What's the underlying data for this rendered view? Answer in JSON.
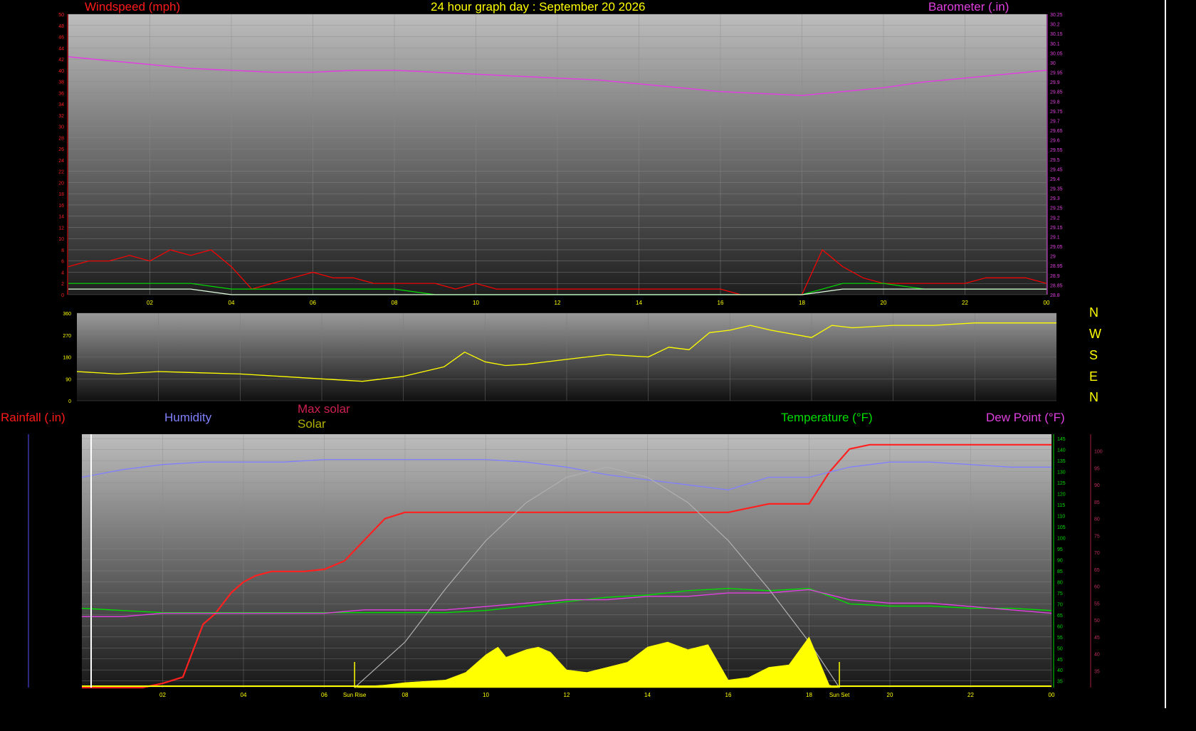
{
  "chart_data": [
    {
      "type": "line",
      "title": "24 hour graph day : September 20 2026",
      "left_axis_label": "Windspeed (mph)",
      "right_axis_label": "Barometer (.in)",
      "x_ticks": [
        "02",
        "04",
        "06",
        "08",
        "10",
        "12",
        "14",
        "16",
        "18",
        "20",
        "22",
        "00"
      ],
      "y_left_ticks": [
        "0",
        "2",
        "4",
        "6",
        "8",
        "10",
        "12",
        "14",
        "16",
        "18",
        "20",
        "22",
        "24",
        "26",
        "28",
        "30",
        "32",
        "34",
        "36",
        "38",
        "40",
        "42",
        "44",
        "46",
        "48",
        "50"
      ],
      "y_right_ticks": [
        "28.8",
        "28.85",
        "28.9",
        "28.95",
        "29",
        "29.05",
        "29.1",
        "29.15",
        "29.2",
        "29.25",
        "29.3",
        "29.35",
        "29.4",
        "29.45",
        "29.5",
        "29.55",
        "29.6",
        "29.65",
        "29.7",
        "29.75",
        "29.8",
        "29.85",
        "29.9",
        "29.95",
        "30",
        "30.05",
        "30.1",
        "30.15",
        "30.2",
        "30.25"
      ],
      "ylim_left": [
        0,
        50
      ],
      "ylim_right": [
        28.8,
        30.25
      ],
      "x_range_hours": [
        0,
        24
      ],
      "series": [
        {
          "name": "Barometer (.in)",
          "color": "#e040e0",
          "x": [
            0,
            1,
            2,
            3,
            4,
            5,
            6,
            7,
            8,
            9,
            10,
            11,
            12,
            13,
            14,
            15,
            16,
            17,
            18,
            19,
            20,
            21,
            22,
            23,
            24
          ],
          "values": [
            30.03,
            30.01,
            29.99,
            29.97,
            29.96,
            29.95,
            29.95,
            29.96,
            29.96,
            29.95,
            29.94,
            29.93,
            29.92,
            29.91,
            29.89,
            29.87,
            29.85,
            29.84,
            29.83,
            29.85,
            29.87,
            29.9,
            29.92,
            29.94,
            29.96
          ]
        },
        {
          "name": "Gust",
          "color": "#ff0000",
          "x": [
            0,
            0.5,
            1,
            1.5,
            2,
            2.5,
            3,
            3.5,
            4,
            4.5,
            5,
            5.5,
            6,
            6.5,
            7,
            7.5,
            8,
            8.5,
            9,
            9.5,
            10,
            10.5,
            11,
            11.5,
            12,
            12.5,
            13,
            13.5,
            14,
            14.5,
            15,
            15.5,
            16,
            16.5,
            17,
            17.5,
            18,
            18.5,
            19,
            19.5,
            20,
            20.5,
            21,
            21.5,
            22,
            22.5,
            23,
            23.5,
            24
          ],
          "values": [
            5,
            6,
            6,
            7,
            6,
            8,
            7,
            8,
            5,
            1,
            2,
            3,
            4,
            3,
            3,
            2,
            2,
            2,
            2,
            1,
            2,
            1,
            1,
            1,
            1,
            1,
            1,
            1,
            1,
            1,
            1,
            1,
            1,
            0,
            0,
            0,
            0,
            8,
            5,
            3,
            2,
            2,
            2,
            2,
            2,
            3,
            3,
            3,
            2
          ]
        },
        {
          "name": "Average",
          "color": "#00dd00",
          "x": [
            0,
            1,
            2,
            3,
            4,
            5,
            6,
            7,
            8,
            9,
            10,
            11,
            12,
            13,
            14,
            15,
            16,
            17,
            18,
            19,
            20,
            21,
            22,
            23,
            24
          ],
          "values": [
            2,
            2,
            2,
            2,
            1,
            1,
            1,
            1,
            1,
            0,
            0,
            0,
            0,
            0,
            0,
            0,
            0,
            0,
            0,
            2,
            2,
            1,
            1,
            1,
            1
          ]
        },
        {
          "name": "Speed",
          "color": "#e0ffe0",
          "x": [
            0,
            1,
            2,
            3,
            4,
            5,
            6,
            7,
            8,
            9,
            10,
            11,
            12,
            13,
            14,
            15,
            16,
            17,
            18,
            19,
            20,
            21,
            22,
            23,
            24
          ],
          "values": [
            1,
            1,
            1,
            1,
            0,
            0,
            0,
            0,
            0,
            0,
            0,
            0,
            0,
            0,
            0,
            0,
            0,
            0,
            0,
            1,
            1,
            1,
            1,
            1,
            1
          ]
        }
      ]
    },
    {
      "type": "scatter",
      "title": "",
      "y_ticks": [
        "0",
        "90",
        "180",
        "270",
        "360"
      ],
      "ylim": [
        0,
        360
      ],
      "direction_labels": [
        "N",
        "W",
        "S",
        "E",
        "N"
      ],
      "series": [
        {
          "name": "Wind direction",
          "color": "#ffff00",
          "x": [
            0,
            1,
            2,
            3,
            4,
            5,
            6,
            7,
            8,
            9,
            9.5,
            10,
            10.5,
            11,
            12,
            13,
            14,
            14.5,
            15,
            15.5,
            16,
            16.5,
            17,
            18,
            18.5,
            19,
            20,
            21,
            22,
            23,
            24
          ],
          "values": [
            120,
            110,
            120,
            115,
            110,
            100,
            90,
            80,
            100,
            140,
            200,
            160,
            145,
            150,
            170,
            190,
            180,
            220,
            210,
            280,
            290,
            310,
            290,
            260,
            310,
            300,
            310,
            310,
            320,
            320,
            320
          ]
        }
      ]
    },
    {
      "type": "line",
      "title": "",
      "left_axis_label": "Rainfall (.in)",
      "humidity_label": "Humidity",
      "max_solar_label": "Max solar",
      "solar_label": "Solar",
      "temperature_label": "Temperature (°F)",
      "dew_point_label": "Dew Point (°F)",
      "x_ticks": [
        "02",
        "04",
        "06",
        "08",
        "10",
        "12",
        "14",
        "16",
        "18",
        "20",
        "22",
        "00"
      ],
      "sunrise_label": "Sun Rise",
      "sunset_label": "Sun Set",
      "sunrise_hour": 6.75,
      "sunset_hour": 18.75,
      "temp_ticks": [
        "35",
        "40",
        "45",
        "50",
        "55",
        "60",
        "65",
        "70",
        "75",
        "80",
        "85",
        "90",
        "95",
        "100",
        "105",
        "110",
        "115",
        "120",
        "125",
        "130",
        "135",
        "140",
        "145"
      ],
      "dew_ticks": [
        "35",
        "40",
        "45",
        "50",
        "55",
        "60",
        "65",
        "70",
        "75",
        "80",
        "85",
        "90",
        "95",
        "100"
      ],
      "temp_range": [
        32,
        147
      ],
      "dew_range": [
        30,
        105
      ],
      "rain_range": [
        0,
        1.2
      ],
      "humidity_range": [
        0,
        100
      ],
      "solar_range": [
        0,
        1000
      ],
      "series": [
        {
          "name": "Rainfall (.in)",
          "color": "#ff2020",
          "x": [
            0,
            0.5,
            1,
            1.5,
            2,
            2.5,
            3,
            3.3,
            3.7,
            4,
            4.3,
            4.7,
            5,
            5.5,
            6,
            6.5,
            7,
            7.5,
            8,
            9,
            10,
            11,
            12,
            13,
            14,
            15,
            16,
            16.5,
            17,
            18,
            18.5,
            19,
            19.5,
            20,
            21,
            22,
            23,
            24
          ],
          "values": [
            0,
            0,
            0,
            0,
            0.02,
            0.05,
            0.3,
            0.35,
            0.45,
            0.5,
            0.53,
            0.55,
            0.55,
            0.55,
            0.56,
            0.6,
            0.7,
            0.8,
            0.83,
            0.83,
            0.83,
            0.83,
            0.83,
            0.83,
            0.83,
            0.83,
            0.83,
            0.85,
            0.87,
            0.87,
            1.02,
            1.13,
            1.15,
            1.15,
            1.15,
            1.15,
            1.15,
            1.15
          ]
        },
        {
          "name": "Humidity",
          "color": "#8080ff",
          "x": [
            0,
            1,
            2,
            3,
            4,
            5,
            6,
            7,
            8,
            9,
            10,
            11,
            12,
            13,
            14,
            15,
            16,
            17,
            18,
            19,
            20,
            21,
            22,
            23,
            24
          ],
          "values": [
            83,
            86,
            88,
            89,
            89,
            89,
            90,
            90,
            90,
            90,
            90,
            89,
            87,
            84,
            82,
            80,
            78,
            83,
            83,
            87,
            89,
            89,
            88,
            87,
            87
          ]
        },
        {
          "name": "Temperature (°F)",
          "color": "#00dd00",
          "x": [
            0,
            1,
            2,
            3,
            4,
            5,
            6,
            7,
            8,
            9,
            10,
            11,
            12,
            13,
            14,
            15,
            16,
            17,
            18,
            19,
            20,
            21,
            22,
            23,
            24
          ],
          "values": [
            68,
            67,
            66,
            66,
            66,
            66,
            66,
            66,
            66,
            66,
            67,
            69,
            71,
            73,
            74,
            76,
            77,
            76,
            77,
            70,
            69,
            69,
            68,
            68,
            67
          ]
        },
        {
          "name": "Dew Point (°F)",
          "color": "#e040e0",
          "x": [
            0,
            1,
            2,
            3,
            4,
            5,
            6,
            7,
            8,
            9,
            10,
            11,
            12,
            13,
            14,
            15,
            16,
            17,
            18,
            19,
            20,
            21,
            22,
            23,
            24
          ],
          "values": [
            51,
            51,
            52,
            52,
            52,
            52,
            52,
            53,
            53,
            53,
            54,
            55,
            56,
            56,
            57,
            57,
            58,
            58,
            59,
            56,
            55,
            55,
            54,
            53,
            52
          ]
        },
        {
          "name": "Max solar",
          "color": "#b0b0b0",
          "x": [
            6.75,
            8,
            9,
            10,
            11,
            12,
            13,
            14,
            15,
            16,
            17,
            18,
            18.75
          ],
          "values": [
            0,
            180,
            390,
            580,
            730,
            830,
            870,
            830,
            730,
            580,
            390,
            180,
            0
          ]
        },
        {
          "name": "Solar",
          "color": "#ffff00",
          "x": [
            6.75,
            7,
            7.5,
            8,
            8.5,
            9,
            9.5,
            10,
            10.3,
            10.5,
            11,
            11.3,
            11.6,
            12,
            12.5,
            13,
            13.5,
            14,
            14.5,
            15,
            15.5,
            16,
            16.5,
            17,
            17.5,
            18,
            18.5,
            18.75
          ],
          "values": [
            0,
            5,
            10,
            20,
            25,
            30,
            60,
            130,
            160,
            120,
            150,
            160,
            140,
            70,
            60,
            80,
            100,
            160,
            180,
            150,
            170,
            30,
            40,
            80,
            90,
            200,
            10,
            0
          ]
        }
      ]
    }
  ]
}
